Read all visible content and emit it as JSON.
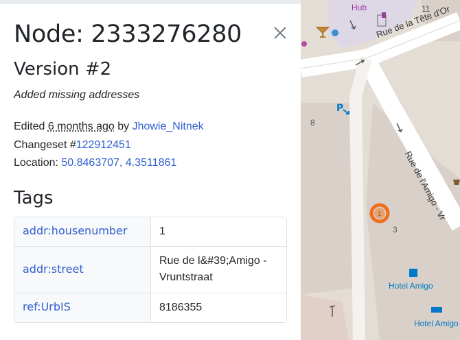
{
  "sidebar": {
    "title": "Node: 2333276280",
    "version": "Version #2",
    "comment": "Added missing addresses",
    "edited_prefix": "Edited ",
    "edited_time": "6 months ago",
    "edited_by": " by ",
    "user": "Jhowie_Nitnek",
    "changeset_label": "Changeset #",
    "changeset_id": "122912451",
    "location_label": "Location: ",
    "location": "50.8463707, 4.3511861",
    "tags_heading": "Tags",
    "tags": [
      {
        "key": "addr:housenumber",
        "value": "1"
      },
      {
        "key": "addr:street",
        "value": "Rue de l&#39;Amigo - Vruntstraat"
      },
      {
        "key": "ref:UrbIS",
        "value": "8186355"
      }
    ]
  },
  "map": {
    "street_1": "Rue de la Tête d'Or",
    "street_2": "Rue de l'Amigo - Vr",
    "hub_label": "Hub",
    "hotel_label_1": "Hotel Amigo",
    "hotel_label_2": "Hotel Amigo",
    "number_8": "8",
    "number_3": "3",
    "number_11": "11",
    "node_marker_label": "1",
    "parking_label": "P",
    "colors": {
      "accent": "#2f5fd0",
      "marker": "#f06d1e",
      "hotel": "#0079c8"
    }
  }
}
